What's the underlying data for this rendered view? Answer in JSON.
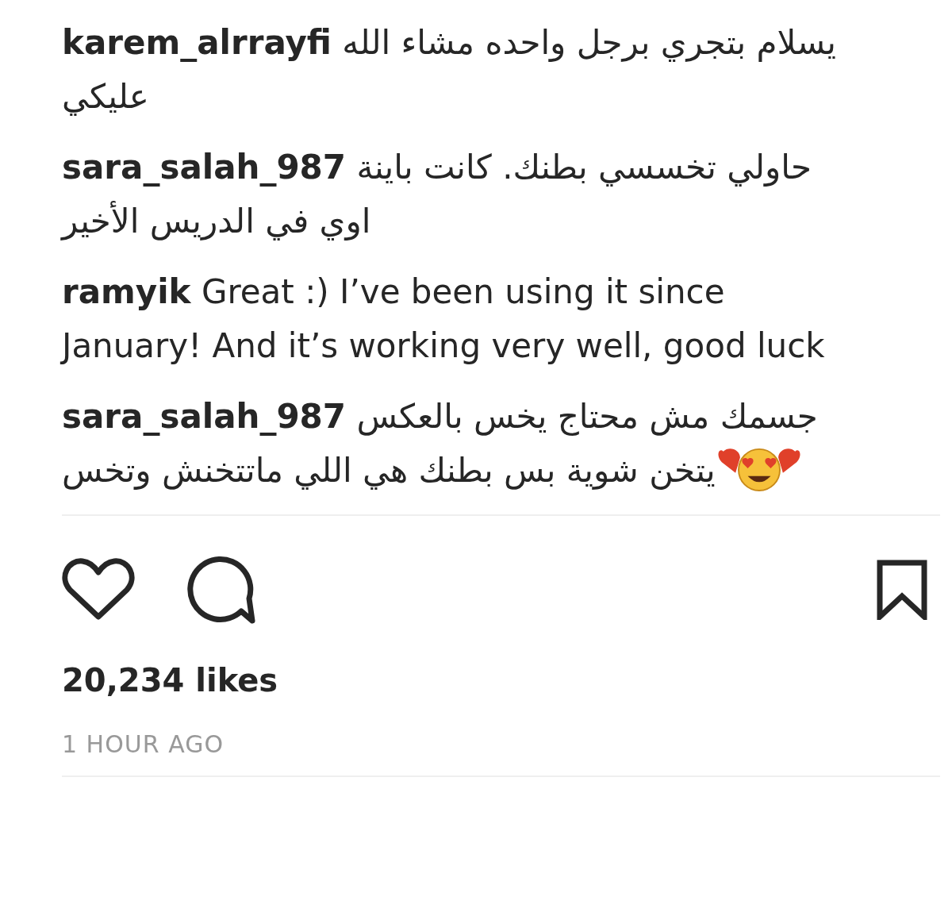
{
  "comments": [
    {
      "username": "karem_alrrayfi",
      "text": "يسلام بتجري برجل واحده مشاء الله عليكي",
      "emoji": false
    },
    {
      "username": "sara_salah_987",
      "text": "حاولي تخسسي بطنك. كانت باينة اوي في الدريس الأخير",
      "emoji": false
    },
    {
      "username": "ramyik",
      "text": "Great :) I’ve been using it since January! And it’s working very well, good luck",
      "emoji": false
    },
    {
      "username": "sara_salah_987",
      "text": "جسمك مش محتاج يخس بالعكس يتخن شوية بس بطنك هي اللي ماتتخنش وتخس",
      "emoji": true
    }
  ],
  "actions": {
    "liked": false,
    "saved": false
  },
  "likes": "20,234 likes",
  "timestamp": "1 HOUR AGO"
}
